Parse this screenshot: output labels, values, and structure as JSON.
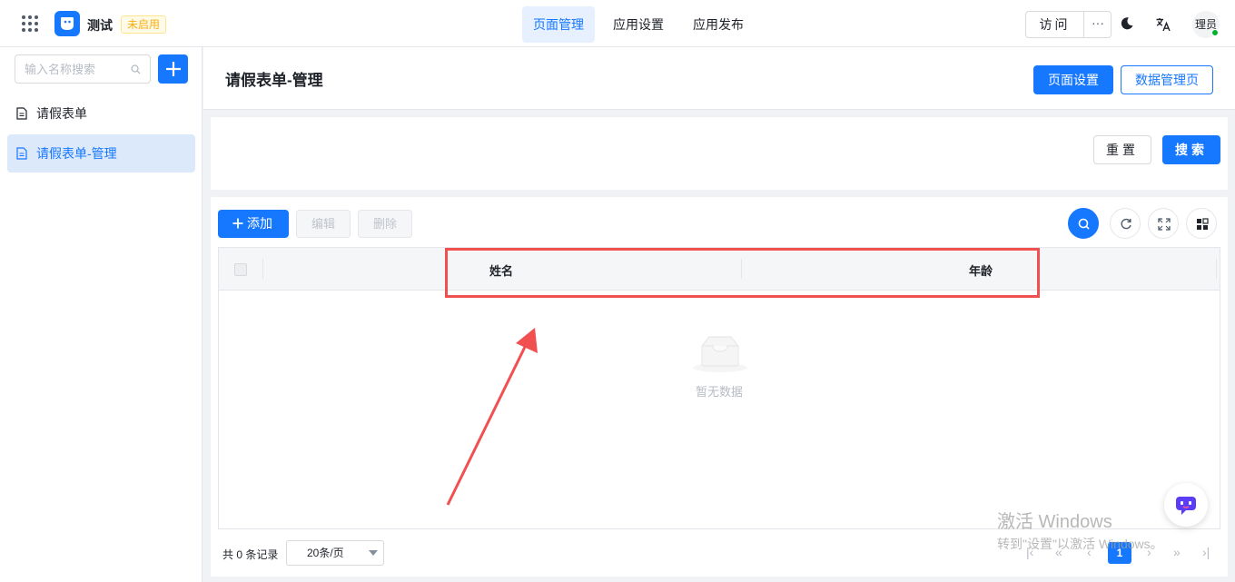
{
  "header": {
    "app_name": "测试",
    "app_status": "未启用",
    "nav_tabs": [
      {
        "label": "页面管理",
        "active": true
      },
      {
        "label": "应用设置",
        "active": false
      },
      {
        "label": "应用发布",
        "active": false
      }
    ],
    "visit_label": "访问",
    "more_label": "···",
    "user_label": "理员"
  },
  "sidebar": {
    "search_placeholder": "输入名称搜索",
    "items": [
      {
        "label": "请假表单",
        "active": false
      },
      {
        "label": "请假表单-管理",
        "active": true
      }
    ]
  },
  "page": {
    "title": "请假表单-管理",
    "settings_button": "页面设置",
    "data_manage_button": "数据管理页"
  },
  "filter": {
    "reset_button": "重置",
    "search_button": "搜索"
  },
  "toolbar": {
    "add_button": "添加",
    "edit_button": "编辑",
    "delete_button": "删除"
  },
  "table": {
    "columns": [
      "姓名",
      "年龄"
    ],
    "rows": [],
    "empty_text": "暂无数据"
  },
  "pagination": {
    "total_text": "共 0 条记录",
    "page_size": "20条/页",
    "current_page": "1"
  },
  "watermark": {
    "line1": "激活 Windows",
    "line2": "转到\"设置\"以激活 Windows。"
  },
  "colors": {
    "primary": "#1677ff",
    "annotation": "#f05050",
    "status_warning": "#faad14",
    "online": "#00b42a"
  }
}
